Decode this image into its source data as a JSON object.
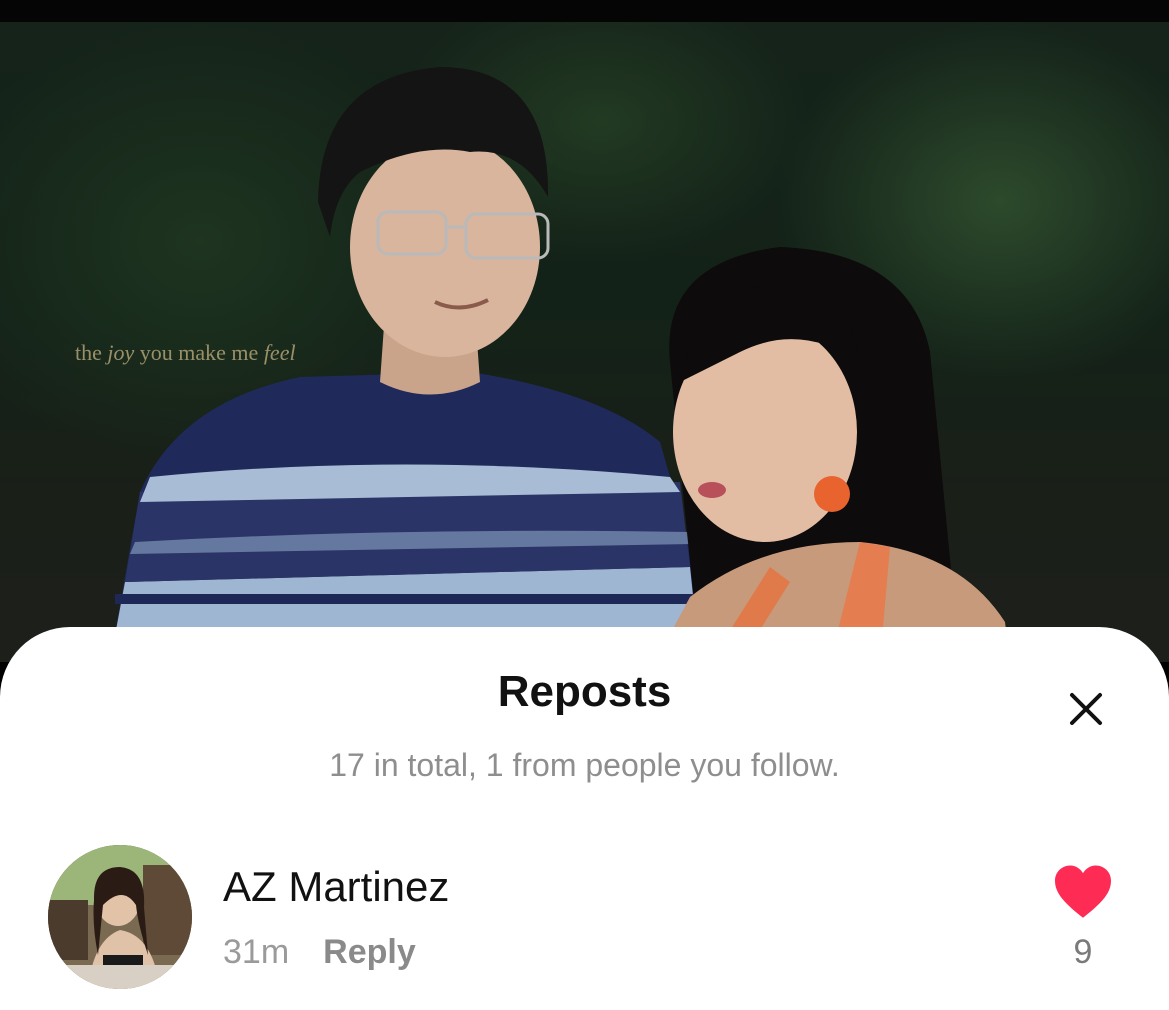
{
  "video": {
    "caption_prefix": "the",
    "caption_em1": "joy",
    "caption_mid": "you make me",
    "caption_em2": "feel"
  },
  "sheet": {
    "title": "Reposts",
    "subtitle": "17 in total, 1 from people you follow."
  },
  "reposts": [
    {
      "username": "AZ Martinez",
      "time_ago": "31m",
      "reply_label": "Reply",
      "like_count": "9"
    }
  ],
  "colors": {
    "accent_heart": "#fe2c55",
    "text_primary": "#111111",
    "text_secondary": "#8e8e8e"
  },
  "icons": {
    "close": "close-icon",
    "like": "heart-icon"
  }
}
